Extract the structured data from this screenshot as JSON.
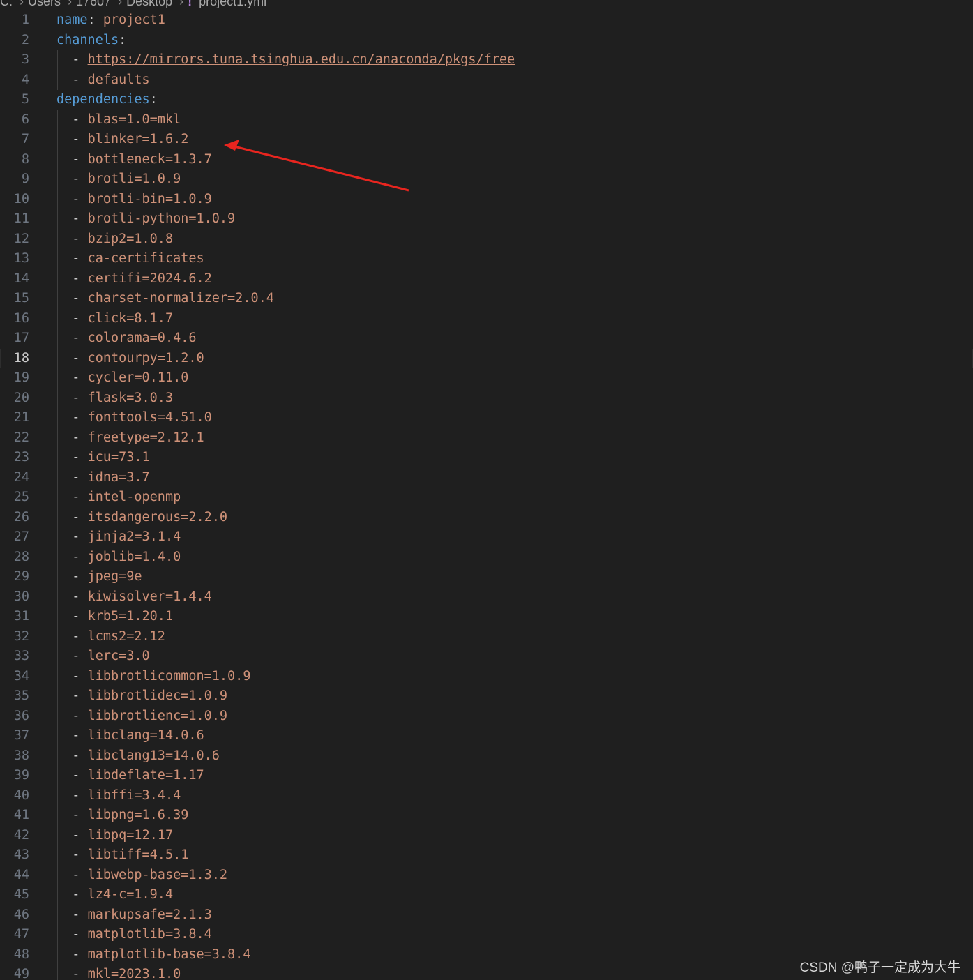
{
  "breadcrumb": {
    "items": [
      "C:",
      "Users",
      "17607",
      "Desktop"
    ],
    "file_icon": "!",
    "file_name": "project1.yml"
  },
  "editor": {
    "current_line": 18,
    "lines": [
      {
        "num": "1",
        "kind": "kv",
        "key": "name",
        "value": "project1"
      },
      {
        "num": "2",
        "kind": "key",
        "key": "channels"
      },
      {
        "num": "3",
        "kind": "url",
        "value": "https://mirrors.tuna.tsinghua.edu.cn/anaconda/pkgs/free"
      },
      {
        "num": "4",
        "kind": "item",
        "value": "defaults"
      },
      {
        "num": "5",
        "kind": "key",
        "key": "dependencies"
      },
      {
        "num": "6",
        "kind": "item",
        "value": "blas=1.0=mkl"
      },
      {
        "num": "7",
        "kind": "item",
        "value": "blinker=1.6.2"
      },
      {
        "num": "8",
        "kind": "item",
        "value": "bottleneck=1.3.7"
      },
      {
        "num": "9",
        "kind": "item",
        "value": "brotli=1.0.9"
      },
      {
        "num": "10",
        "kind": "item",
        "value": "brotli-bin=1.0.9"
      },
      {
        "num": "11",
        "kind": "item",
        "value": "brotli-python=1.0.9"
      },
      {
        "num": "12",
        "kind": "item",
        "value": "bzip2=1.0.8"
      },
      {
        "num": "13",
        "kind": "item",
        "value": "ca-certificates"
      },
      {
        "num": "14",
        "kind": "item",
        "value": "certifi=2024.6.2"
      },
      {
        "num": "15",
        "kind": "item",
        "value": "charset-normalizer=2.0.4"
      },
      {
        "num": "16",
        "kind": "item",
        "value": "click=8.1.7"
      },
      {
        "num": "17",
        "kind": "item",
        "value": "colorama=0.4.6"
      },
      {
        "num": "18",
        "kind": "item",
        "value": "contourpy=1.2.0"
      },
      {
        "num": "19",
        "kind": "item",
        "value": "cycler=0.11.0"
      },
      {
        "num": "20",
        "kind": "item",
        "value": "flask=3.0.3"
      },
      {
        "num": "21",
        "kind": "item",
        "value": "fonttools=4.51.0"
      },
      {
        "num": "22",
        "kind": "item",
        "value": "freetype=2.12.1"
      },
      {
        "num": "23",
        "kind": "item",
        "value": "icu=73.1"
      },
      {
        "num": "24",
        "kind": "item",
        "value": "idna=3.7"
      },
      {
        "num": "25",
        "kind": "item",
        "value": "intel-openmp"
      },
      {
        "num": "26",
        "kind": "item",
        "value": "itsdangerous=2.2.0"
      },
      {
        "num": "27",
        "kind": "item",
        "value": "jinja2=3.1.4"
      },
      {
        "num": "28",
        "kind": "item",
        "value": "joblib=1.4.0"
      },
      {
        "num": "29",
        "kind": "item",
        "value": "jpeg=9e"
      },
      {
        "num": "30",
        "kind": "item",
        "value": "kiwisolver=1.4.4"
      },
      {
        "num": "31",
        "kind": "item",
        "value": "krb5=1.20.1"
      },
      {
        "num": "32",
        "kind": "item",
        "value": "lcms2=2.12"
      },
      {
        "num": "33",
        "kind": "item",
        "value": "lerc=3.0"
      },
      {
        "num": "34",
        "kind": "item",
        "value": "libbrotlicommon=1.0.9"
      },
      {
        "num": "35",
        "kind": "item",
        "value": "libbrotlidec=1.0.9"
      },
      {
        "num": "36",
        "kind": "item",
        "value": "libbrotlienc=1.0.9"
      },
      {
        "num": "37",
        "kind": "item",
        "value": "libclang=14.0.6"
      },
      {
        "num": "38",
        "kind": "item",
        "value": "libclang13=14.0.6"
      },
      {
        "num": "39",
        "kind": "item",
        "value": "libdeflate=1.17"
      },
      {
        "num": "40",
        "kind": "item",
        "value": "libffi=3.4.4"
      },
      {
        "num": "41",
        "kind": "item",
        "value": "libpng=1.6.39"
      },
      {
        "num": "42",
        "kind": "item",
        "value": "libpq=12.17"
      },
      {
        "num": "43",
        "kind": "item",
        "value": "libtiff=4.5.1"
      },
      {
        "num": "44",
        "kind": "item",
        "value": "libwebp-base=1.3.2"
      },
      {
        "num": "45",
        "kind": "item",
        "value": "lz4-c=1.9.4"
      },
      {
        "num": "46",
        "kind": "item",
        "value": "markupsafe=2.1.3"
      },
      {
        "num": "47",
        "kind": "item",
        "value": "matplotlib=3.8.4"
      },
      {
        "num": "48",
        "kind": "item",
        "value": "matplotlib-base=3.8.4"
      },
      {
        "num": "49",
        "kind": "item",
        "value": "mkl=2023.1.0"
      }
    ]
  },
  "annotation": {
    "arrow_color": "#e8251f"
  },
  "watermark": "CSDN @鸭子一定成为大牛",
  "colors": {
    "background": "#1f1f1f",
    "key": "#569cd6",
    "string": "#ce9178",
    "line_number": "#6e7681"
  }
}
